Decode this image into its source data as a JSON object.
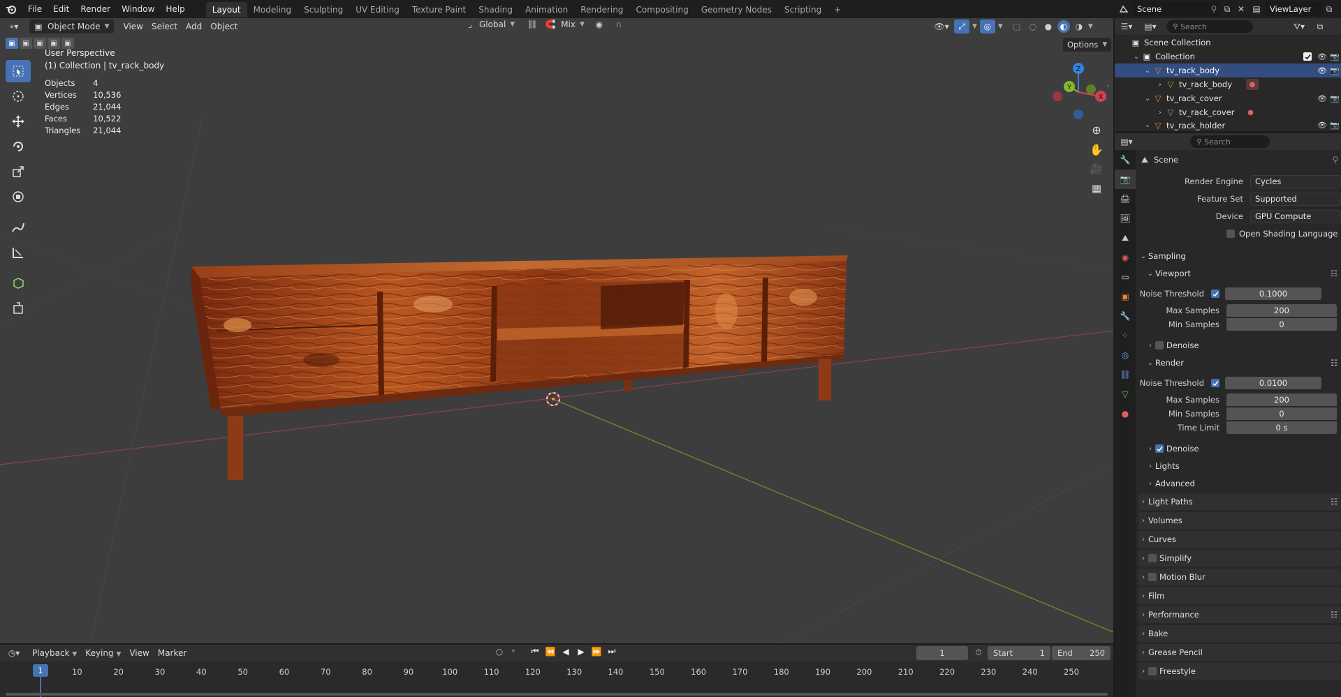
{
  "topbar": {
    "menus": [
      "File",
      "Edit",
      "Render",
      "Window",
      "Help"
    ],
    "workspaces": [
      "Layout",
      "Modeling",
      "Sculpting",
      "UV Editing",
      "Texture Paint",
      "Shading",
      "Animation",
      "Rendering",
      "Compositing",
      "Geometry Nodes",
      "Scripting"
    ],
    "active_workspace": "Layout",
    "add_tab": "+",
    "scene_name": "Scene",
    "view_layer": "ViewLayer"
  },
  "viewport": {
    "mode": "Object Mode",
    "menus": [
      "View",
      "Select",
      "Add",
      "Object"
    ],
    "orientation": "Global",
    "proportional": "Mix",
    "options_label": "Options",
    "perspective_label": "User Perspective",
    "collection_label": "(1) Collection | tv_rack_body",
    "stats": [
      {
        "label": "Objects",
        "value": "4"
      },
      {
        "label": "Vertices",
        "value": "10,536"
      },
      {
        "label": "Edges",
        "value": "21,044"
      },
      {
        "label": "Faces",
        "value": "10,522"
      },
      {
        "label": "Triangles",
        "value": "21,044"
      }
    ],
    "gizmo_axes": {
      "z": "Z",
      "y": "Y",
      "x": "X"
    }
  },
  "outliner": {
    "search_placeholder": "Search",
    "rows": [
      {
        "label": "Scene Collection"
      },
      {
        "label": "Collection"
      },
      {
        "label": "tv_rack_body"
      },
      {
        "label": "tv_rack_body"
      },
      {
        "label": "tv_rack_cover"
      },
      {
        "label": "tv_rack_cover"
      },
      {
        "label": "tv_rack_holder"
      }
    ]
  },
  "properties": {
    "search_placeholder": "Search",
    "context": "Scene",
    "render_engine_label": "Render Engine",
    "render_engine": "Cycles",
    "feature_set_label": "Feature Set",
    "feature_set": "Supported",
    "device_label": "Device",
    "device": "GPU Compute",
    "osl_label": "Open Shading Language",
    "sampling": {
      "title": "Sampling",
      "viewport_title": "Viewport",
      "viewport_noise_label": "Noise Threshold",
      "viewport_noise": "0.1000",
      "viewport_max_label": "Max Samples",
      "viewport_max": "200",
      "viewport_min_label": "Min Samples",
      "viewport_min": "0",
      "viewport_denoise": "Denoise",
      "render_title": "Render",
      "render_noise_label": "Noise Threshold",
      "render_noise": "0.0100",
      "render_max_label": "Max Samples",
      "render_max": "200",
      "render_min_label": "Min Samples",
      "render_min": "0",
      "time_limit_label": "Time Limit",
      "time_limit": "0 s",
      "render_denoise": "Denoise",
      "lights": "Lights",
      "advanced": "Advanced"
    },
    "panels": [
      "Light Paths",
      "Volumes",
      "Curves",
      "Simplify",
      "Motion Blur",
      "Film",
      "Performance",
      "Bake",
      "Grease Pencil",
      "Freestyle"
    ]
  },
  "timeline": {
    "menus": [
      "Playback",
      "Keying",
      "View",
      "Marker"
    ],
    "current_frame": "1",
    "start_label": "Start",
    "start": "1",
    "end_label": "End",
    "end": "250",
    "ticks": [
      "1",
      "10",
      "20",
      "30",
      "40",
      "50",
      "60",
      "70",
      "80",
      "90",
      "100",
      "110",
      "120",
      "130",
      "140",
      "150",
      "160",
      "170",
      "180",
      "190",
      "200",
      "210",
      "220",
      "230",
      "240",
      "250"
    ]
  },
  "colors": {
    "accent": "#4772b3",
    "x_axis": "#d4414f",
    "y_axis": "#86b82f",
    "z_axis": "#2f85e0",
    "wood": "#a4461c",
    "object_orange": "#e88a32",
    "mesh_green": "#6cc24a"
  }
}
